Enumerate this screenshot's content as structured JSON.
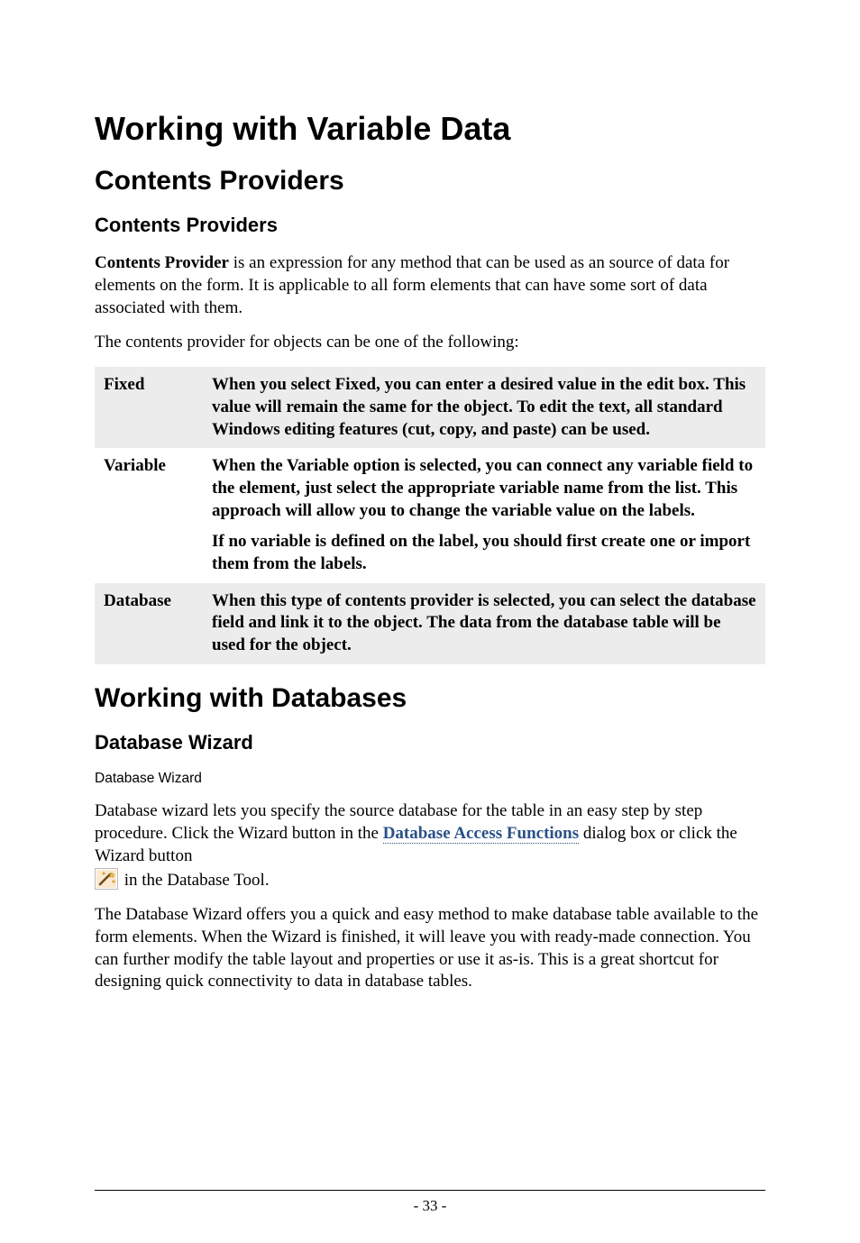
{
  "headings": {
    "chapter": "Working with Variable Data",
    "section1": "Contents Providers",
    "subsection1": "Contents Providers",
    "section2": "Working with Databases",
    "subsection2": "Database Wizard",
    "subhead": "Database Wizard"
  },
  "paragraphs": {
    "intro_lead": "Contents Provider",
    "intro_rest": " is an expression for any method that can be used as an source of data for elements on the form. It is applicable to all form elements that can have some sort of data associated with them.",
    "intro2": "The contents provider for objects can be one of the following:",
    "db_p1_a": "Database wizard lets you specify the source database for the table in an easy step by step procedure. Click the Wizard button in the ",
    "db_link": "Database Access Functions",
    "db_p1_b": " dialog box or click the Wizard button ",
    "db_p1_c": " in the Database Tool.",
    "db_p2": "The Database Wizard offers you a quick and easy method to make database table available to the form elements. When the Wizard is finished, it will leave you with ready-made connection. You can further modify the table layout and properties or use it as-is. This is a great shortcut for designing quick connectivity to data in database tables."
  },
  "table": {
    "rows": [
      {
        "term": "Fixed",
        "shaded": true,
        "paras": [
          "When you select Fixed, you can enter a desired value in the edit box. This value will remain the same for the object. To edit the text, all standard Windows editing features (cut, copy, and paste) can be used."
        ]
      },
      {
        "term": "Variable",
        "shaded": false,
        "paras": [
          "When the Variable option is selected, you can connect any variable field to the element, just select the appropriate variable name from the list. This approach will allow you to change the variable value on the labels.",
          "If no variable is defined on the label, you should first create one or import them from the labels."
        ]
      },
      {
        "term": "Database",
        "shaded": true,
        "paras": [
          "When this type of contents provider is selected, you can select the database field and link it to the object. The data from the database table will be used for the object."
        ]
      }
    ]
  },
  "footer": {
    "page": "- 33 -"
  }
}
